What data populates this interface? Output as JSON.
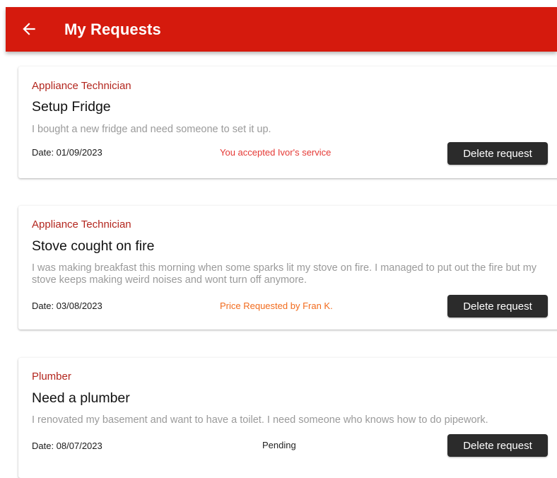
{
  "appbar": {
    "back_icon": "arrow-left-icon",
    "title": "My Requests",
    "color": "#d51a0d"
  },
  "requests": [
    {
      "category": "Appliance Technician",
      "title": "Setup Fridge",
      "description": "I bought a new fridge and need someone to set it up.",
      "date": "Date: 01/09/2023",
      "status": "You accepted Ivor's service",
      "status_color": "#e53935",
      "delete_label": "Delete request"
    },
    {
      "category": "Appliance Technician",
      "title": "Stove cought on fire",
      "description": "I was making breakfast this morning when some sparks lit my stove on fire.  I managed to put out the fire but my stove keeps making weird noises and wont turn off anymore.",
      "date": "Date: 03/08/2023",
      "status": "Price Requested by Fran K.",
      "status_color": "#f26b1d",
      "delete_label": "Delete request"
    },
    {
      "category": "Plumber",
      "title": "Need a plumber",
      "description": "I renovated my basement and want to have a toilet. I need someone who knows how to do pipework.",
      "date": "Date: 08/07/2023",
      "status": "Pending",
      "status_color": "#222222",
      "delete_label": "Delete request"
    }
  ]
}
